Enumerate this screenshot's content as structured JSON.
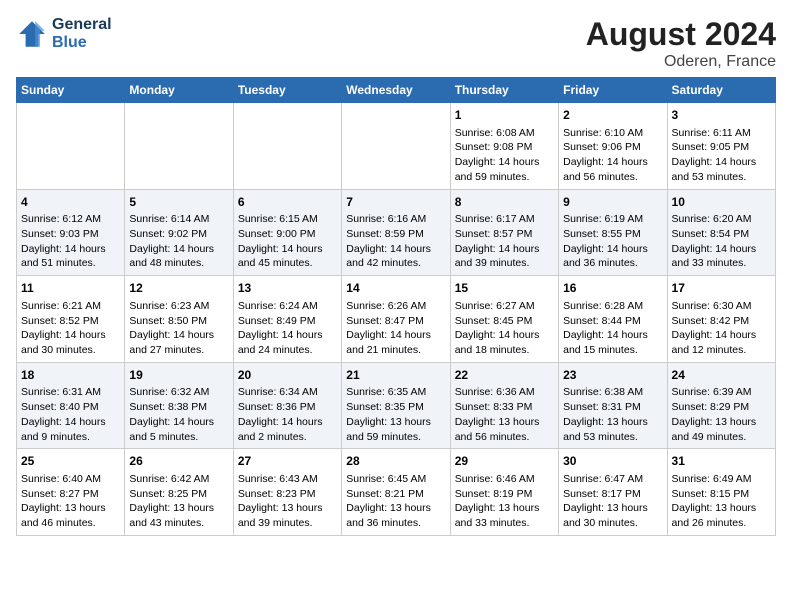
{
  "header": {
    "logo_line1": "General",
    "logo_line2": "Blue",
    "month_year": "August 2024",
    "location": "Oderen, France"
  },
  "weekdays": [
    "Sunday",
    "Monday",
    "Tuesday",
    "Wednesday",
    "Thursday",
    "Friday",
    "Saturday"
  ],
  "weeks": [
    [
      {
        "day": "",
        "content": ""
      },
      {
        "day": "",
        "content": ""
      },
      {
        "day": "",
        "content": ""
      },
      {
        "day": "",
        "content": ""
      },
      {
        "day": "1",
        "content": "Sunrise: 6:08 AM\nSunset: 9:08 PM\nDaylight: 14 hours\nand 59 minutes."
      },
      {
        "day": "2",
        "content": "Sunrise: 6:10 AM\nSunset: 9:06 PM\nDaylight: 14 hours\nand 56 minutes."
      },
      {
        "day": "3",
        "content": "Sunrise: 6:11 AM\nSunset: 9:05 PM\nDaylight: 14 hours\nand 53 minutes."
      }
    ],
    [
      {
        "day": "4",
        "content": "Sunrise: 6:12 AM\nSunset: 9:03 PM\nDaylight: 14 hours\nand 51 minutes."
      },
      {
        "day": "5",
        "content": "Sunrise: 6:14 AM\nSunset: 9:02 PM\nDaylight: 14 hours\nand 48 minutes."
      },
      {
        "day": "6",
        "content": "Sunrise: 6:15 AM\nSunset: 9:00 PM\nDaylight: 14 hours\nand 45 minutes."
      },
      {
        "day": "7",
        "content": "Sunrise: 6:16 AM\nSunset: 8:59 PM\nDaylight: 14 hours\nand 42 minutes."
      },
      {
        "day": "8",
        "content": "Sunrise: 6:17 AM\nSunset: 8:57 PM\nDaylight: 14 hours\nand 39 minutes."
      },
      {
        "day": "9",
        "content": "Sunrise: 6:19 AM\nSunset: 8:55 PM\nDaylight: 14 hours\nand 36 minutes."
      },
      {
        "day": "10",
        "content": "Sunrise: 6:20 AM\nSunset: 8:54 PM\nDaylight: 14 hours\nand 33 minutes."
      }
    ],
    [
      {
        "day": "11",
        "content": "Sunrise: 6:21 AM\nSunset: 8:52 PM\nDaylight: 14 hours\nand 30 minutes."
      },
      {
        "day": "12",
        "content": "Sunrise: 6:23 AM\nSunset: 8:50 PM\nDaylight: 14 hours\nand 27 minutes."
      },
      {
        "day": "13",
        "content": "Sunrise: 6:24 AM\nSunset: 8:49 PM\nDaylight: 14 hours\nand 24 minutes."
      },
      {
        "day": "14",
        "content": "Sunrise: 6:26 AM\nSunset: 8:47 PM\nDaylight: 14 hours\nand 21 minutes."
      },
      {
        "day": "15",
        "content": "Sunrise: 6:27 AM\nSunset: 8:45 PM\nDaylight: 14 hours\nand 18 minutes."
      },
      {
        "day": "16",
        "content": "Sunrise: 6:28 AM\nSunset: 8:44 PM\nDaylight: 14 hours\nand 15 minutes."
      },
      {
        "day": "17",
        "content": "Sunrise: 6:30 AM\nSunset: 8:42 PM\nDaylight: 14 hours\nand 12 minutes."
      }
    ],
    [
      {
        "day": "18",
        "content": "Sunrise: 6:31 AM\nSunset: 8:40 PM\nDaylight: 14 hours\nand 9 minutes."
      },
      {
        "day": "19",
        "content": "Sunrise: 6:32 AM\nSunset: 8:38 PM\nDaylight: 14 hours\nand 5 minutes."
      },
      {
        "day": "20",
        "content": "Sunrise: 6:34 AM\nSunset: 8:36 PM\nDaylight: 14 hours\nand 2 minutes."
      },
      {
        "day": "21",
        "content": "Sunrise: 6:35 AM\nSunset: 8:35 PM\nDaylight: 13 hours\nand 59 minutes."
      },
      {
        "day": "22",
        "content": "Sunrise: 6:36 AM\nSunset: 8:33 PM\nDaylight: 13 hours\nand 56 minutes."
      },
      {
        "day": "23",
        "content": "Sunrise: 6:38 AM\nSunset: 8:31 PM\nDaylight: 13 hours\nand 53 minutes."
      },
      {
        "day": "24",
        "content": "Sunrise: 6:39 AM\nSunset: 8:29 PM\nDaylight: 13 hours\nand 49 minutes."
      }
    ],
    [
      {
        "day": "25",
        "content": "Sunrise: 6:40 AM\nSunset: 8:27 PM\nDaylight: 13 hours\nand 46 minutes."
      },
      {
        "day": "26",
        "content": "Sunrise: 6:42 AM\nSunset: 8:25 PM\nDaylight: 13 hours\nand 43 minutes."
      },
      {
        "day": "27",
        "content": "Sunrise: 6:43 AM\nSunset: 8:23 PM\nDaylight: 13 hours\nand 39 minutes."
      },
      {
        "day": "28",
        "content": "Sunrise: 6:45 AM\nSunset: 8:21 PM\nDaylight: 13 hours\nand 36 minutes."
      },
      {
        "day": "29",
        "content": "Sunrise: 6:46 AM\nSunset: 8:19 PM\nDaylight: 13 hours\nand 33 minutes."
      },
      {
        "day": "30",
        "content": "Sunrise: 6:47 AM\nSunset: 8:17 PM\nDaylight: 13 hours\nand 30 minutes."
      },
      {
        "day": "31",
        "content": "Sunrise: 6:49 AM\nSunset: 8:15 PM\nDaylight: 13 hours\nand 26 minutes."
      }
    ]
  ]
}
